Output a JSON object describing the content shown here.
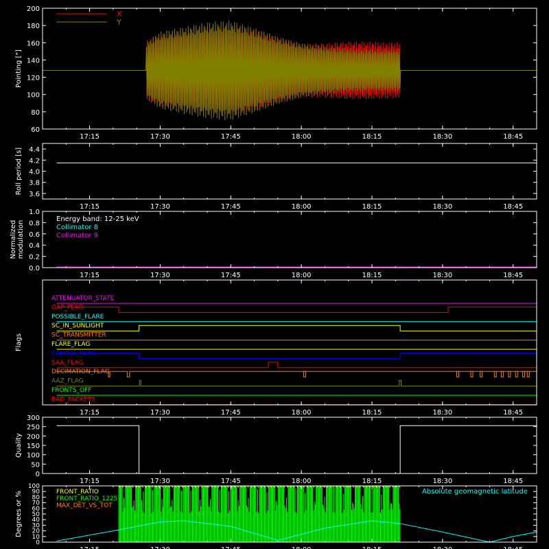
{
  "xaxis": {
    "tick_labels": [
      "17:15",
      "17:30",
      "17:45",
      "18:00",
      "18:15",
      "18:30",
      "18:45"
    ],
    "tick_minutes": [
      1035,
      1050,
      1065,
      1080,
      1095,
      1110,
      1125
    ],
    "range_minutes": [
      1025,
      1130
    ],
    "label_color": "#ffffff"
  },
  "chart_data": [
    {
      "id": "pointing",
      "type": "line",
      "ylabel": "Pointing [\"]",
      "ylim": [
        60,
        200
      ],
      "y_ticks": [
        60,
        80,
        100,
        120,
        140,
        160,
        180,
        200
      ],
      "legend": [
        "X",
        "Y"
      ],
      "series": [
        {
          "name": "X",
          "color": "#ff0000",
          "center": 128,
          "amplitude_env": [
            [
              1028,
              0
            ],
            [
              1047,
              0
            ],
            [
              1047,
              30
            ],
            [
              1050,
              38
            ],
            [
              1055,
              42
            ],
            [
              1060,
              45
            ],
            [
              1065,
              47
            ],
            [
              1070,
              43
            ],
            [
              1075,
              35
            ],
            [
              1080,
              28
            ],
            [
              1085,
              28
            ],
            [
              1090,
              30
            ],
            [
              1095,
              30
            ],
            [
              1098,
              29
            ],
            [
              1101,
              29
            ],
            [
              1101,
              0
            ],
            [
              1130,
              0
            ]
          ]
        },
        {
          "name": "Y",
          "color": "#807f00",
          "center": 128,
          "amplitude_env": [
            [
              1028,
              0
            ],
            [
              1047,
              0
            ],
            [
              1047,
              30
            ],
            [
              1050,
              40
            ],
            [
              1055,
              45
            ],
            [
              1060,
              50
            ],
            [
              1065,
              52
            ],
            [
              1070,
              44
            ],
            [
              1075,
              35
            ],
            [
              1080,
              28
            ],
            [
              1085,
              25
            ],
            [
              1090,
              23
            ],
            [
              1095,
              22
            ],
            [
              1098,
              22
            ],
            [
              1101,
              22
            ],
            [
              1101,
              0
            ],
            [
              1130,
              0
            ]
          ]
        }
      ]
    },
    {
      "id": "roll",
      "type": "line",
      "ylabel": "Roll period [s]",
      "ylim": [
        3.5,
        4.5
      ],
      "y_ticks": [
        3.6,
        3.8,
        4.0,
        4.2,
        4.4
      ],
      "series": [
        {
          "color": "#ffffff",
          "x": [
            1028,
            1130
          ],
          "y": [
            4.15,
            4.15
          ]
        }
      ]
    },
    {
      "id": "modulation",
      "type": "line",
      "ylabel": "Normalized modulation",
      "ylim": [
        0,
        1
      ],
      "y_ticks": [
        0.0,
        0.2,
        0.4,
        0.6,
        0.8,
        1.0
      ],
      "annotations": [
        {
          "text": "Energy band: 12-25 keV",
          "color": "#ffffff"
        },
        {
          "text": "Collimator 8",
          "color": "#00ffff"
        },
        {
          "text": "Collimator 9",
          "color": "#ff00ff"
        }
      ],
      "series": [
        {
          "color": "#ff00ff",
          "x": [
            1028,
            1130
          ],
          "y": [
            0,
            0
          ]
        }
      ]
    },
    {
      "id": "flags",
      "type": "line",
      "ylabel": "Flags",
      "rows": [
        {
          "name": "ATTENUATOR_STATE",
          "color": "#ff00ff",
          "segments": [
            [
              1028,
              0
            ],
            [
              1130,
              0
            ]
          ]
        },
        {
          "name": "GAP_FLAG",
          "color": "#ff0000",
          "segments": [
            [
              1028,
              1
            ],
            [
              1041.2,
              1
            ],
            [
              1041.2,
              0
            ],
            [
              1111.2,
              0
            ],
            [
              1111.2,
              1
            ],
            [
              1130,
              1
            ]
          ]
        },
        {
          "name": "POSSIBLE_FLARE",
          "color": "#00ffff",
          "segments": [
            [
              1028,
              0
            ],
            [
              1130,
              0
            ]
          ]
        },
        {
          "name": "SC_IN_SUNLIGHT",
          "color": "#ffff00",
          "segments": [
            [
              1028,
              0
            ],
            [
              1045.5,
              0
            ],
            [
              1045.5,
              1
            ],
            [
              1101,
              1
            ],
            [
              1101,
              0
            ],
            [
              1130,
              0
            ]
          ]
        },
        {
          "name": "SC_TRANSMITTER",
          "color": "#ff7f00",
          "segments": [
            [
              1028,
              0
            ],
            [
              1130,
              0
            ]
          ]
        },
        {
          "name": "FLARE_FLAG",
          "color": "#ffff00",
          "segments": [
            [
              1028,
              0
            ],
            [
              1130,
              0
            ]
          ]
        },
        {
          "name": "ECLIPSE_FLAG",
          "color": "#0000ff",
          "segments": [
            [
              1028,
              1
            ],
            [
              1045.5,
              1
            ],
            [
              1045.5,
              0
            ],
            [
              1101,
              0
            ],
            [
              1101,
              1
            ],
            [
              1130,
              1
            ]
          ]
        },
        {
          "name": "SAA_FLAG",
          "color": "#ff0000",
          "segments": [
            [
              1028,
              0
            ],
            [
              1073,
              0
            ],
            [
              1073,
              1
            ],
            [
              1075,
              1
            ],
            [
              1075,
              0
            ],
            [
              1130,
              0
            ]
          ]
        },
        {
          "name": "DECIMATION_FLAG",
          "color": "#ff7f00",
          "segments": [
            [
              1028,
              1
            ],
            [
              1039,
              1
            ],
            [
              1039,
              0
            ],
            [
              1039.3,
              0
            ],
            [
              1039.3,
              1
            ],
            [
              1043,
              1
            ],
            [
              1043,
              0
            ],
            [
              1043.5,
              0
            ],
            [
              1043.5,
              1
            ],
            [
              1130,
              1
            ]
          ]
        },
        {
          "name": "AAZ_FLAG",
          "color": "#807f00",
          "segments": [
            [
              1028,
              0
            ],
            [
              1045.6,
              0
            ],
            [
              1045.6,
              1
            ],
            [
              1045.9,
              1
            ],
            [
              1045.9,
              0
            ],
            [
              1100.8,
              0
            ],
            [
              1100.8,
              1
            ],
            [
              1101.2,
              1
            ],
            [
              1101.2,
              0
            ],
            [
              1130,
              0
            ]
          ]
        },
        {
          "name": "FRONTS_OFF",
          "color": "#00ff00",
          "segments": [
            [
              1028,
              0
            ],
            [
              1130,
              0
            ]
          ]
        },
        {
          "name": "BAD_PACKETS",
          "color": "#ff0000",
          "segments": [
            [
              1028,
              0
            ],
            [
              1130,
              0
            ]
          ]
        }
      ]
    },
    {
      "id": "quality",
      "type": "line",
      "ylabel": "Quality",
      "ylim": [
        0,
        300
      ],
      "y_ticks": [
        0,
        50,
        100,
        150,
        200,
        250,
        300
      ],
      "series": [
        {
          "color": "#ffffff",
          "x": [
            1028,
            1045.5,
            1045.5,
            1101,
            1101,
            1130
          ],
          "y": [
            255,
            255,
            0,
            0,
            255,
            255
          ]
        }
      ]
    },
    {
      "id": "bottom",
      "type": "line",
      "ylabel": "Degrees or %",
      "ylim": [
        0,
        100
      ],
      "y_ticks": [
        0,
        10,
        20,
        30,
        40,
        50,
        60,
        70,
        80,
        90,
        100
      ],
      "legend": [
        {
          "name": "FRONT_RATIO",
          "color": "#ffff00"
        },
        {
          "name": "FRONT_RATIO_1225",
          "color": "#00ff00"
        },
        {
          "name": "MAX_DET_VS_TOT",
          "color": "#ff7f00"
        }
      ],
      "annotation": {
        "text": "Absolute geomagnetic latitude",
        "color": "#00ffff"
      },
      "green_band": [
        1041.2,
        1101
      ],
      "latitude": {
        "color": "#00ffff",
        "x": [
          1028,
          1040,
          1050,
          1055,
          1065,
          1075,
          1085,
          1095,
          1101,
          1110,
          1120,
          1125,
          1130
        ],
        "y": [
          2,
          20,
          36,
          38,
          28,
          3,
          25,
          38,
          33,
          18,
          0,
          10,
          18
        ]
      }
    }
  ]
}
